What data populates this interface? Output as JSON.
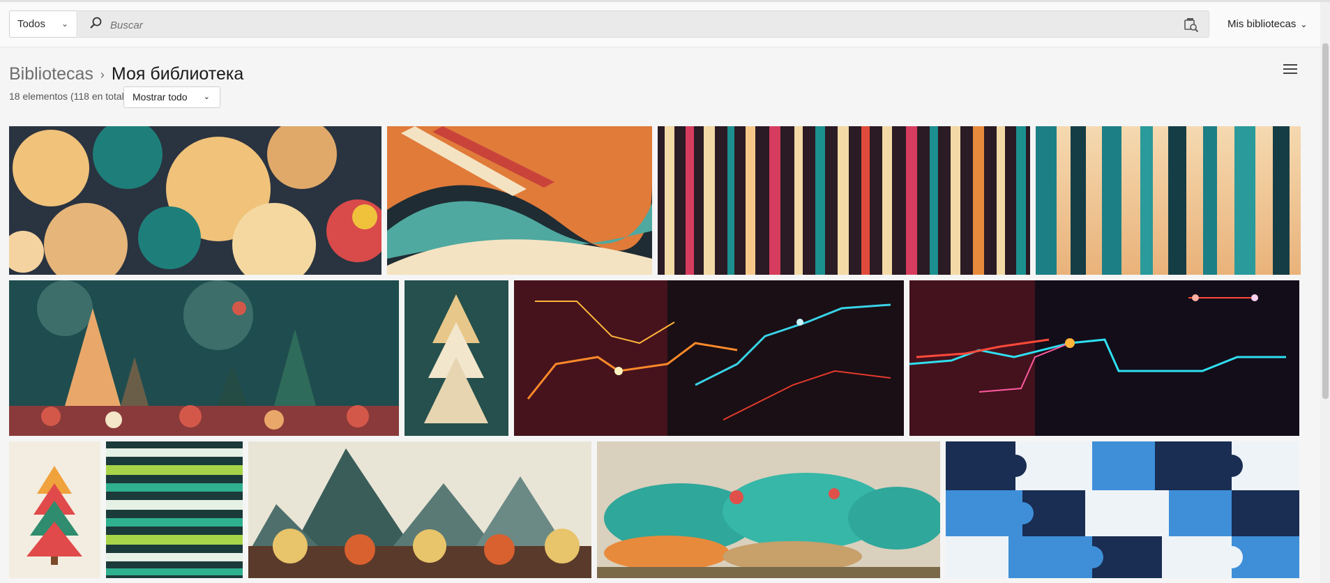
{
  "header": {
    "filter_label": "Todos",
    "search_placeholder": "Buscar",
    "my_libraries_label": "Mis bibliotecas"
  },
  "breadcrumb": {
    "parent": "Bibliotecas",
    "separator": "›",
    "current": "Моя библиотека"
  },
  "library": {
    "count_text": "18 elementos (118 en total)",
    "show_filter": "Mostrar todo"
  },
  "icons": {
    "filter_dropdown": "chevron-down-icon",
    "search": "search-icon",
    "visual_search": "visual-search-icon",
    "libraries_dropdown": "chevron-down-icon",
    "view_menu": "list-view-icon"
  },
  "gallery": [
    {
      "subject": "colorful jigsaw puzzle pieces",
      "colors": [
        "#f0c27a",
        "#1e7f7a",
        "#2a3340",
        "#d94a4a"
      ]
    },
    {
      "subject": "abstract retro wave stripes",
      "colors": [
        "#e07b3a",
        "#4fa9a0",
        "#1f2c33",
        "#f4e3c2"
      ]
    },
    {
      "subject": "vertical color bars",
      "colors": [
        "#f2d9a6",
        "#d63c5e",
        "#1c8f8f",
        "#2b1b24"
      ]
    },
    {
      "subject": "teal forest trees",
      "colors": [
        "#1d7f86",
        "#e9b27a",
        "#153d45",
        "#f5d9b0"
      ]
    },
    {
      "subject": "festive christmas trees bokeh",
      "colors": [
        "#1f4d4f",
        "#d4584a",
        "#e9a86a",
        "#f4e6c8"
      ]
    },
    {
      "subject": "minimal golden christmas tree",
      "colors": [
        "#25504d",
        "#e8c88a",
        "#f2e6cc"
      ]
    },
    {
      "subject": "neon circuit lines orange cyan",
      "colors": [
        "#1a0f14",
        "#ff8a2a",
        "#39d3e8",
        "#b81e2e"
      ]
    },
    {
      "subject": "neon circuit lines red blue",
      "colors": [
        "#130d1a",
        "#ff4a3a",
        "#2ee0f0",
        "#ffb43a"
      ]
    },
    {
      "subject": "layered christmas tree",
      "colors": [
        "#f3ede1",
        "#e14a4a",
        "#2f8c6e",
        "#f0a23c"
      ]
    },
    {
      "subject": "horizontal green stripes",
      "colors": [
        "#1b3a3a",
        "#a8d44a",
        "#2fb08e",
        "#e6f1e6"
      ]
    },
    {
      "subject": "mountain landscape autumn",
      "colors": [
        "#3b5d5a",
        "#e8c46a",
        "#d9602f",
        "#e9e5d6"
      ]
    },
    {
      "subject": "teal and orange tangled fibers",
      "colors": [
        "#2fa79a",
        "#e88a3c",
        "#d9d0bd",
        "#7a6a4a"
      ]
    },
    {
      "subject": "blue jigsaw puzzle",
      "colors": [
        "#1a2d52",
        "#3e8fd8",
        "#9ccbf0",
        "#eef3f8"
      ]
    }
  ]
}
